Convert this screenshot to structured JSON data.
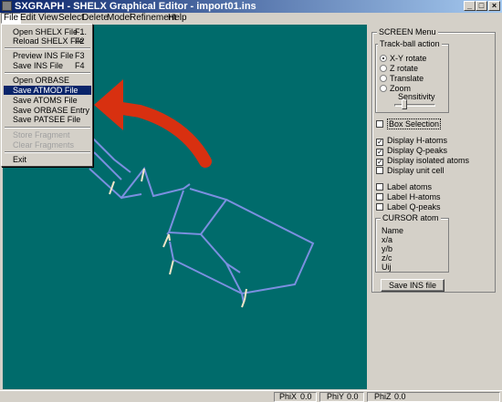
{
  "window": {
    "title": "SXGRAPH - SHELX Graphical Editor - import01.ins",
    "minimize_glyph": "_",
    "maximize_glyph": "□",
    "close_glyph": "×"
  },
  "menubar": {
    "items": [
      "File",
      "Edit",
      "View",
      "Select",
      "Delete",
      "Model",
      "Refinement",
      "Help"
    ]
  },
  "file_menu": {
    "groups": [
      [
        {
          "label": "Open SHELX File ...",
          "shortcut": "F1"
        },
        {
          "label": "Reload SHELX File",
          "shortcut": "F2"
        }
      ],
      [
        {
          "label": "Preview INS File",
          "shortcut": "F3"
        },
        {
          "label": "Save INS File",
          "shortcut": "F4"
        }
      ],
      [
        {
          "label": "Open ORBASE",
          "shortcut": ""
        },
        {
          "label": "Save ATMOD File",
          "shortcut": "",
          "highlighted": true
        },
        {
          "label": "Save ATOMS File",
          "shortcut": ""
        },
        {
          "label": "Save ORBASE Entry",
          "shortcut": ""
        },
        {
          "label": "Save PATSEE File",
          "shortcut": ""
        }
      ],
      [
        {
          "label": "Store Fragment",
          "shortcut": "",
          "disabled": true
        },
        {
          "label": "Clear Fragments",
          "shortcut": "",
          "disabled": true
        }
      ],
      [
        {
          "label": "Exit",
          "shortcut": ""
        }
      ]
    ]
  },
  "screen_menu": {
    "title": "SCREEN Menu",
    "trackball": {
      "title": "Track-ball action",
      "options": [
        "X-Y rotate",
        "Z rotate",
        "Translate",
        "Zoom"
      ],
      "selected": 0,
      "sensitivity_label": "Sensitivity",
      "sensitivity_level": 0.25
    },
    "box_selection": {
      "label": "Box Selection",
      "checked": false
    },
    "display_options": [
      {
        "label": "Display H-atoms",
        "checked": true
      },
      {
        "label": "Display Q-peaks",
        "checked": true
      },
      {
        "label": "Display isolated atoms",
        "checked": true
      },
      {
        "label": "Display unit cell",
        "checked": false
      }
    ],
    "label_options": [
      {
        "label": "Label atoms",
        "checked": false
      },
      {
        "label": "Label H-atoms",
        "checked": false
      },
      {
        "label": "Label Q-peaks",
        "checked": false
      }
    ],
    "cursor_atom": {
      "title": "CURSOR atom",
      "fields": [
        "Name",
        "x/a",
        "y/b",
        "z/c",
        "Uij"
      ]
    },
    "save_button": "Save INS file"
  },
  "statusbar": {
    "items": [
      {
        "label": "PhiX",
        "value": "0.0"
      },
      {
        "label": "PhiY",
        "value": "0.0"
      },
      {
        "label": "PhiZ",
        "value": "0.0"
      }
    ]
  },
  "colors": {
    "canvas": "#006b6b",
    "bond": "#7b8fe0",
    "hydrogen": "#f0e6c8",
    "annotation_arrow": "#d83010",
    "menu_highlight": "#0a246a"
  }
}
